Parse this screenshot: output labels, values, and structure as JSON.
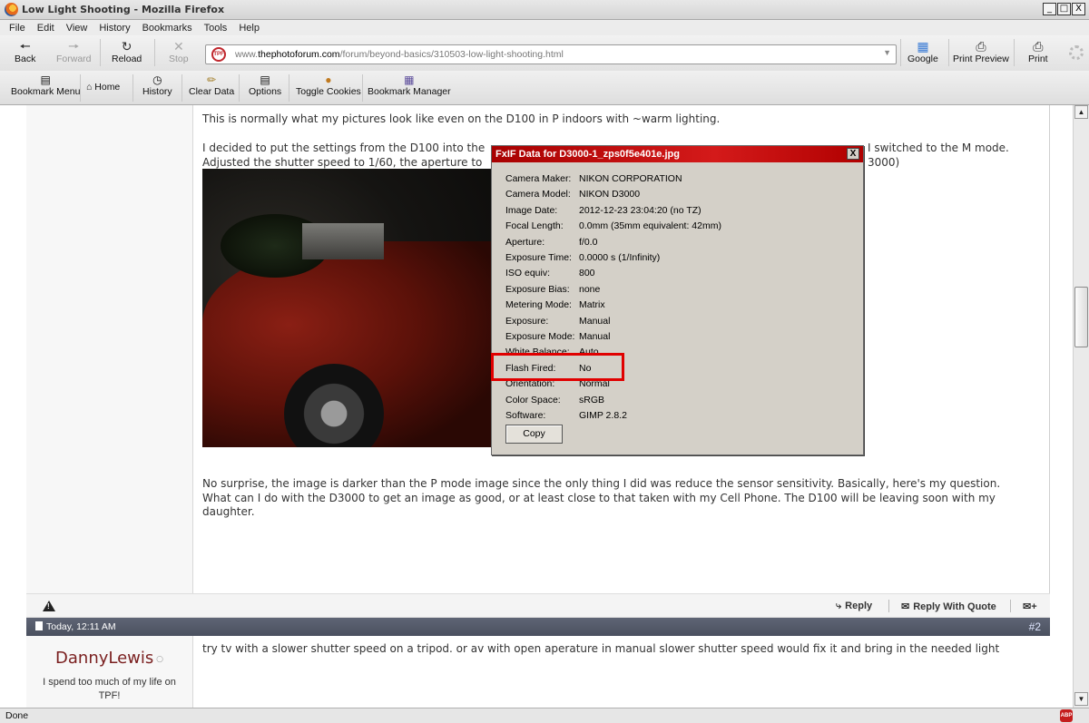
{
  "window": {
    "title": "Low Light Shooting - Mozilla Firefox",
    "min": "_",
    "max": "□",
    "close": "X"
  },
  "menu": [
    "File",
    "Edit",
    "View",
    "History",
    "Bookmarks",
    "Tools",
    "Help"
  ],
  "nav": {
    "back": "Back",
    "forward": "Forward",
    "reload": "Reload",
    "stop": "Stop",
    "url_prefix": "www.",
    "url_domain": "thephotoforum.com",
    "url_path": "/forum/beyond-basics/310503-low-light-shooting.html",
    "site_icon": "TPF",
    "google": "Google",
    "print_preview": "Print Preview",
    "print": "Print"
  },
  "bookmarks": {
    "bookmark_menu": "Bookmark Menu",
    "home": "Home",
    "history": "History",
    "clear_data": "Clear Data",
    "options": "Options",
    "toggle_cookies": "Toggle Cookies",
    "bookmark_manager": "Bookmark Manager"
  },
  "post1": {
    "para1": "This is normally what my pictures look like even on the D100 in P indoors with ~warm lighting.",
    "para2_left_line1": "I decided to put the settings from the D100 into the",
    "para2_right_line1": "I switched to the M mode.",
    "para2_left_line2": "Adjusted the shutter speed to 1/60, the aperture to",
    "para2_right_line2": "3000)",
    "para3": "No surprise, the image is darker than the P mode image since the only thing I did was reduce the sensor sensitivity. Basically, here's my question. What can I do with the D3000 to get an image as good, or at least close to that taken with my Cell Phone. The D100 will be leaving soon with my daughter."
  },
  "post_footer": {
    "reply": "Reply",
    "reply_with_quote": "Reply With Quote"
  },
  "post2": {
    "date": "Today, 12:11 AM",
    "number": "#2",
    "username": "DannyLewis",
    "user_title": "I spend too much of my life on TPF!",
    "text": "try tv with a slower shutter speed on a tripod. or av with open aperature in manual slower shutter speed would fix it and bring in the needed light"
  },
  "fxif": {
    "title": "FxIF Data for D3000-1_zps0f5e401e.jpg",
    "close": "X",
    "rows": [
      {
        "label": "Camera Maker:",
        "value": "NIKON CORPORATION"
      },
      {
        "label": "Camera Model:",
        "value": "NIKON D3000"
      },
      {
        "label": "Image Date:",
        "value": "2012-12-23 23:04:20 (no TZ)"
      },
      {
        "label": "Focal Length:",
        "value": "0.0mm (35mm equivalent: 42mm)"
      },
      {
        "label": "Aperture:",
        "value": "f/0.0"
      },
      {
        "label": "Exposure Time:",
        "value": "0.0000 s (1/Infinity)"
      },
      {
        "label": "ISO equiv:",
        "value": "800"
      },
      {
        "label": "Exposure Bias:",
        "value": "none"
      },
      {
        "label": "Metering Mode:",
        "value": "Matrix"
      },
      {
        "label": "Exposure:",
        "value": "Manual"
      },
      {
        "label": "Exposure Mode:",
        "value": "Manual"
      },
      {
        "label": "White Balance:",
        "value": "Auto"
      },
      {
        "label": "Flash Fired:",
        "value": "No"
      },
      {
        "label": "Orientation:",
        "value": "Normal"
      },
      {
        "label": "Color Space:",
        "value": "sRGB"
      },
      {
        "label": "Software:",
        "value": "GIMP 2.8.2"
      }
    ],
    "copy": "Copy",
    "highlight_color": "#e00000"
  },
  "status": {
    "text": "Done",
    "abp": "ABP"
  }
}
